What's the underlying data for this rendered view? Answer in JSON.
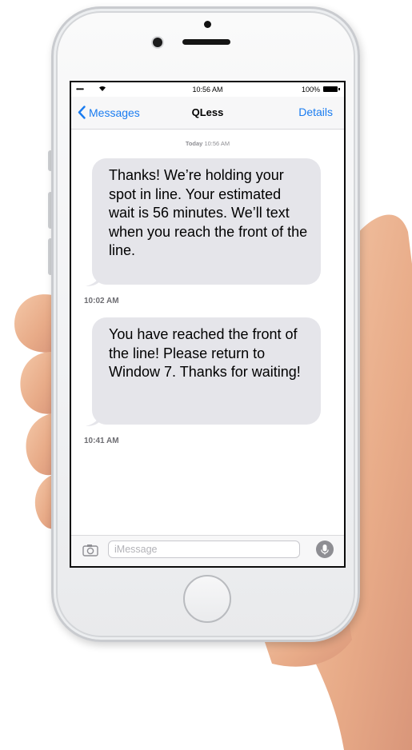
{
  "status_bar": {
    "signal": "•••••",
    "time": "10:56 AM",
    "battery": "100%"
  },
  "nav": {
    "back_label": "Messages",
    "title": "QLess",
    "details_label": "Details"
  },
  "conversation": {
    "header_day": "Today",
    "header_time": "10:56 AM",
    "messages": [
      {
        "text": "Thanks! We’re holding your spot in line. Your estimated wait is 56 minutes. We’ll text when you reach the front of the line.",
        "time": "10:02 AM"
      },
      {
        "text": "You have reached the front of the line! Please return to Window 7. Thanks for waiting!",
        "time": "10:41 AM"
      }
    ]
  },
  "compose": {
    "placeholder": "iMessage"
  },
  "icons": [
    "wifi-icon",
    "battery-icon",
    "chevron-left-icon",
    "camera-icon",
    "microphone-icon"
  ],
  "colors": {
    "accent": "#1a7cf0",
    "bubble": "#e5e5ea",
    "meta_text": "#8e8e93"
  }
}
